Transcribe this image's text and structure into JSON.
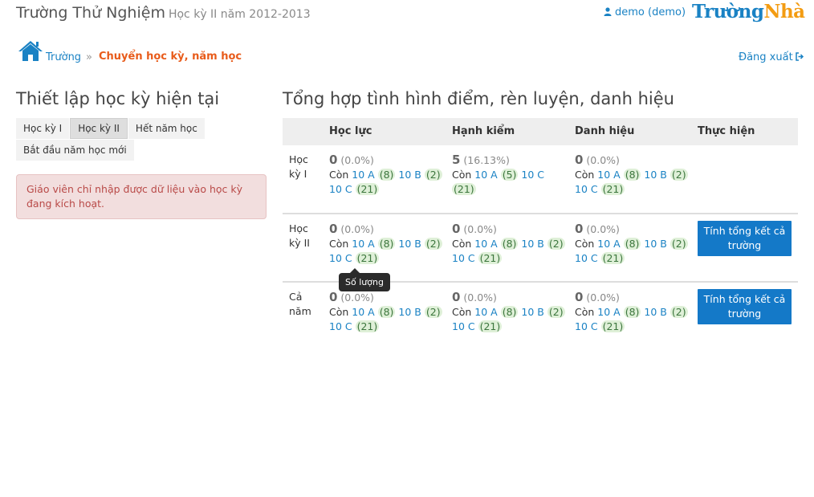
{
  "header": {
    "school_name": "Trường Thử Nghiệm",
    "term": "Học kỳ II năm 2012-2013",
    "user": "demo (demo)",
    "logo_part1": "Trường",
    "logo_part2": "Nhà",
    "logo_color1": "#1a82c4",
    "logo_color2": "#f39c12"
  },
  "breadcrumb": {
    "home": "Trường",
    "separator": "»",
    "current": "Chuyển học kỳ, năm học",
    "logout": "Đăng xuất"
  },
  "left": {
    "title": "Thiết lập học kỳ hiện tại",
    "tabs": [
      "Học kỳ I",
      "Học kỳ II",
      "Hết năm học"
    ],
    "active_tab": "Học kỳ II",
    "new_year_button": "Bắt đầu năm học mới",
    "alert": "Giáo viên chỉ nhập được dữ liệu vào học kỳ đang kích hoạt."
  },
  "right": {
    "title": "Tổng hợp tình hình điểm, rèn luyện, danh hiệu",
    "columns": [
      "Học lực",
      "Hạnh kiểm",
      "Danh hiệu",
      "Thực hiện"
    ],
    "remaining_label": "Còn",
    "rows": [
      {
        "label": "Học kỳ I",
        "cells": [
          {
            "num": "0",
            "pct": "(0.0%)",
            "a": "10 A",
            "a_n": "(8)",
            "b": "10 B",
            "b_n": "(2)",
            "c": "10 C",
            "c_n": "(21)"
          },
          {
            "num": "5",
            "pct": "(16.13%)",
            "a": "10 A",
            "a_n": "(5)",
            "c": "10 C",
            "c_n": "(21)"
          },
          {
            "num": "0",
            "pct": "(0.0%)",
            "a": "10 A",
            "a_n": "(8)",
            "b": "10 B",
            "b_n": "(2)",
            "c": "10 C",
            "c_n": "(21)"
          }
        ]
      },
      {
        "label": "Học kỳ II",
        "button": "Tính tổng kết cả trường",
        "cells": [
          {
            "num": "0",
            "pct": "(0.0%)",
            "a": "10 A",
            "a_n": "(8)",
            "b": "10 B",
            "b_n": "(2)",
            "c": "10 C",
            "c_n": "(21)"
          },
          {
            "num": "0",
            "pct": "(0.0%)",
            "a": "10 A",
            "a_n": "(8)",
            "b": "10 B",
            "b_n": "(2)",
            "c": "10 C",
            "c_n": "(21)"
          },
          {
            "num": "0",
            "pct": "(0.0%)",
            "a": "10 A",
            "a_n": "(8)",
            "b": "10 B",
            "b_n": "(2)",
            "c": "10 C",
            "c_n": "(21)"
          }
        ]
      },
      {
        "label": "Cả năm",
        "button": "Tính tổng kết cả trường",
        "cells": [
          {
            "num": "0",
            "pct": "(0.0%)",
            "a": "10 A",
            "a_n": "(8)",
            "b": "10 B",
            "b_n": "(2)",
            "c": "10 C",
            "c_n": "(21)"
          },
          {
            "num": "0",
            "pct": "(0.0%)",
            "a": "10 A",
            "a_n": "(8)",
            "b": "10 B",
            "b_n": "(2)",
            "c": "10 C",
            "c_n": "(21)"
          },
          {
            "num": "0",
            "pct": "(0.0%)",
            "a": "10 A",
            "a_n": "(8)",
            "b": "10 B",
            "b_n": "(2)",
            "c": "10 C",
            "c_n": "(21)"
          }
        ]
      }
    ],
    "tooltip": "Số lượng"
  },
  "icons": [
    "user-icon",
    "home-icon",
    "logout-icon"
  ]
}
